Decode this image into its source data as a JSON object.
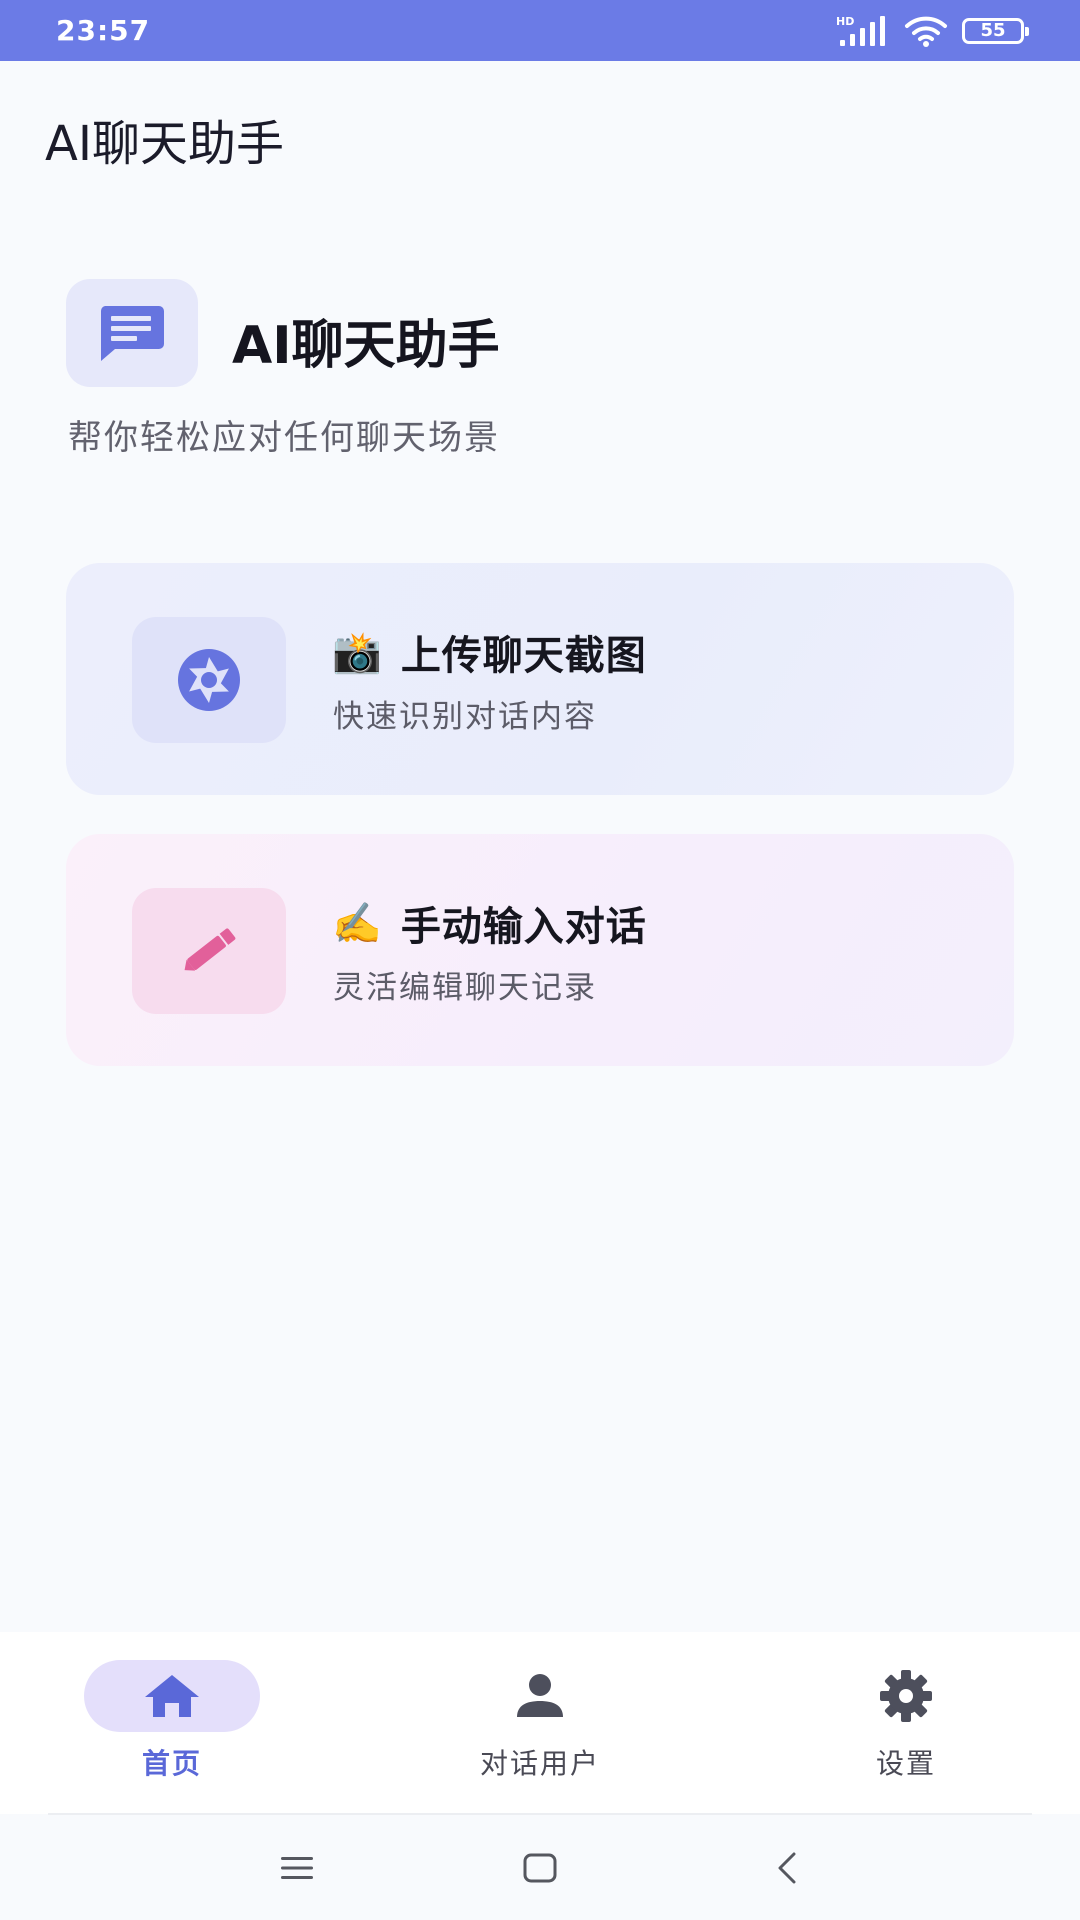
{
  "status_bar": {
    "time": "23:57",
    "network_label": "HD",
    "battery": "55",
    "icons": [
      "signal-icon",
      "wifi-icon",
      "battery-icon"
    ]
  },
  "app_bar": {
    "title": "AI聊天助手"
  },
  "header": {
    "icon": "chat-bubble-icon",
    "title": "AI聊天助手",
    "subtitle": "帮你轻松应对任何聊天场景"
  },
  "cards": [
    {
      "icon": "camera-shutter-icon",
      "emoji": "📸",
      "title": "上传聊天截图",
      "description": "快速识别对话内容",
      "accent": "#6b7be6"
    },
    {
      "icon": "pencil-icon",
      "emoji": "✍️",
      "title": "手动输入对话",
      "description": "灵活编辑聊天记录",
      "accent": "#e2609a"
    }
  ],
  "bottom_nav": {
    "items": [
      {
        "label": "首页",
        "icon": "home-icon",
        "active": true
      },
      {
        "label": "对话用户",
        "icon": "person-icon",
        "active": false
      },
      {
        "label": "设置",
        "icon": "gear-icon",
        "active": false
      }
    ],
    "active_color": "#5a68d8"
  },
  "system_nav": {
    "buttons": [
      "menu-icon",
      "home-square-icon",
      "back-icon"
    ]
  }
}
